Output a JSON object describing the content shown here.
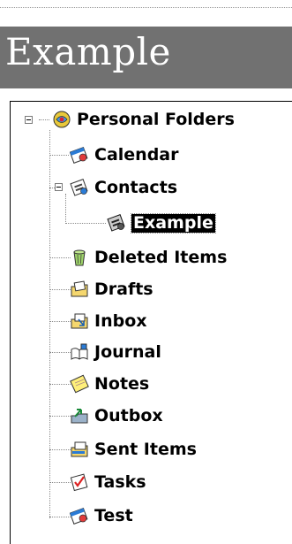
{
  "header": {
    "title": "Example"
  },
  "tree": {
    "root": {
      "label": "Personal Folders",
      "icon": "personal-folders-icon"
    },
    "items": [
      {
        "label": "Calendar",
        "icon": "calendar-icon"
      },
      {
        "label": "Contacts",
        "icon": "contacts-icon"
      },
      {
        "label": "Example",
        "icon": "contacts-icon",
        "selected": true
      },
      {
        "label": "Deleted Items",
        "icon": "trash-icon"
      },
      {
        "label": "Drafts",
        "icon": "drafts-icon"
      },
      {
        "label": "Inbox",
        "icon": "inbox-icon"
      },
      {
        "label": "Journal",
        "icon": "journal-icon"
      },
      {
        "label": "Notes",
        "icon": "notes-icon"
      },
      {
        "label": "Outbox",
        "icon": "outbox-icon"
      },
      {
        "label": "Sent Items",
        "icon": "sent-items-icon"
      },
      {
        "label": "Tasks",
        "icon": "tasks-icon"
      },
      {
        "label": "Test",
        "icon": "calendar-icon"
      }
    ]
  }
}
